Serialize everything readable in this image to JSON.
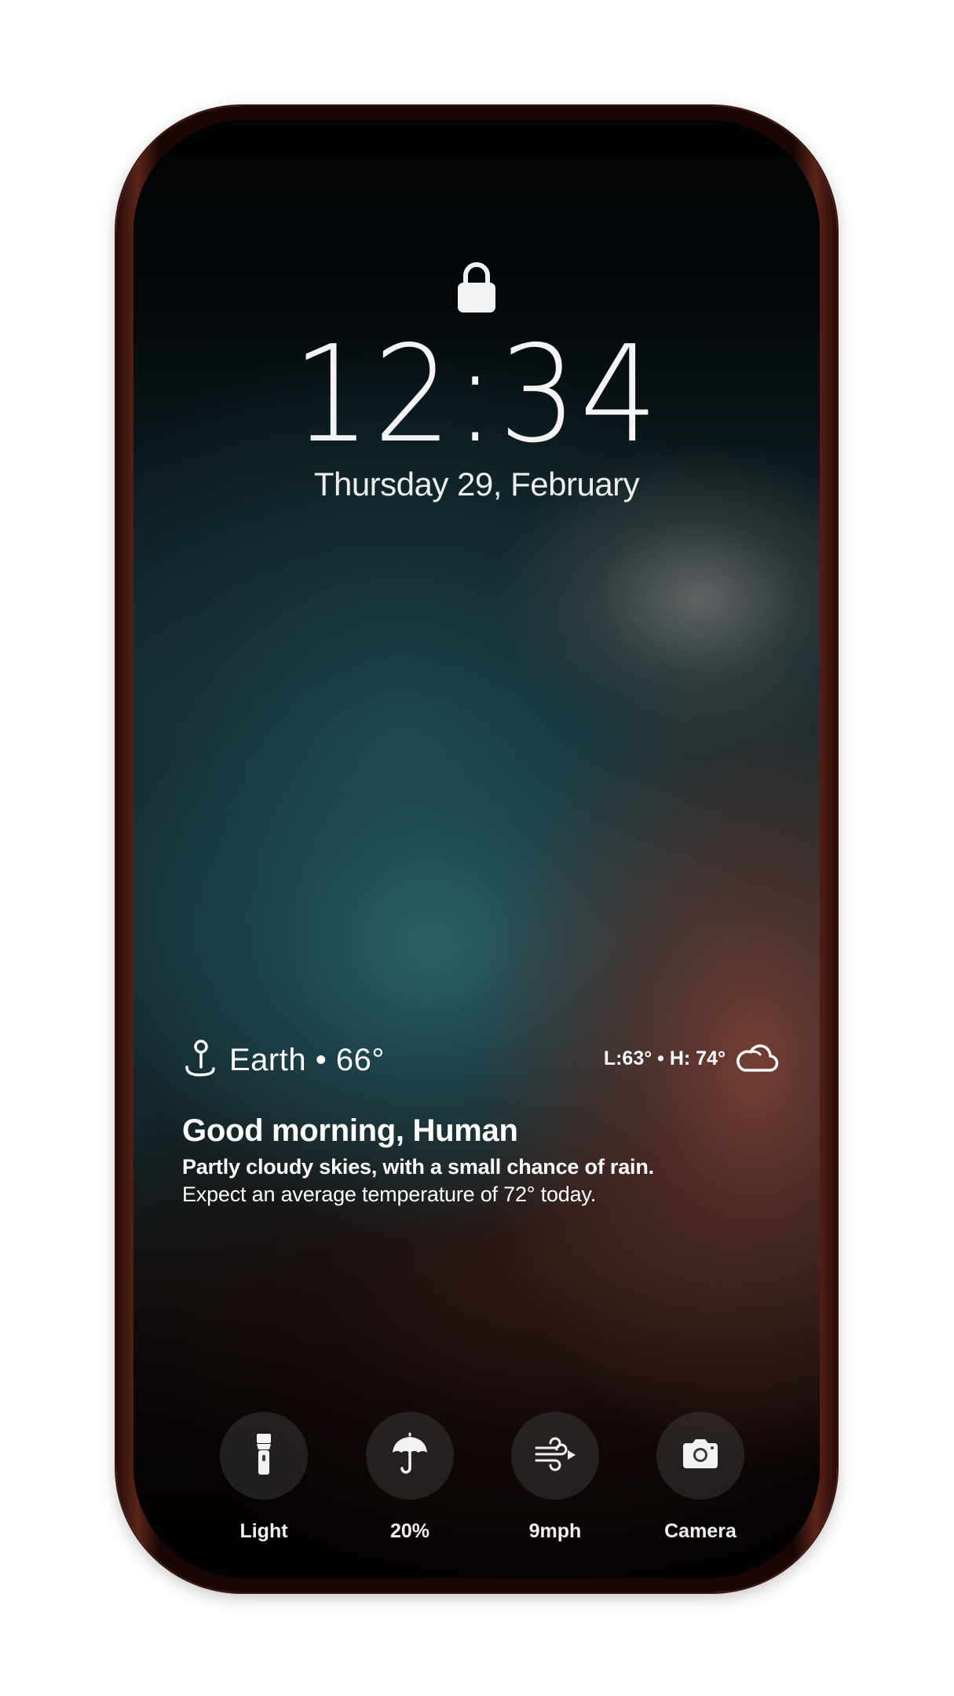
{
  "lock_screen": {
    "time": "12:34",
    "date": "Thursday 29, February"
  },
  "weather": {
    "location_line": "Earth • 66°",
    "high_low": "L:63° • H: 74°",
    "condition_icon": "cloud-icon",
    "location_icon": "pin-icon"
  },
  "greeting": {
    "title": "Good morning, Human",
    "subtitle": "Partly cloudy skies, with a small chance of rain.",
    "detail": "Expect an average temperature of 72° today."
  },
  "quick_actions": [
    {
      "label": "Light",
      "icon": "flashlight-icon"
    },
    {
      "label": "20%",
      "icon": "umbrella-icon"
    },
    {
      "label": "9mph",
      "icon": "wind-icon"
    },
    {
      "label": "Camera",
      "icon": "camera-icon"
    }
  ],
  "colors": {
    "phone_frame": "#3a130d",
    "text": "#ffffff",
    "button_bg": "#2e2e2e"
  }
}
